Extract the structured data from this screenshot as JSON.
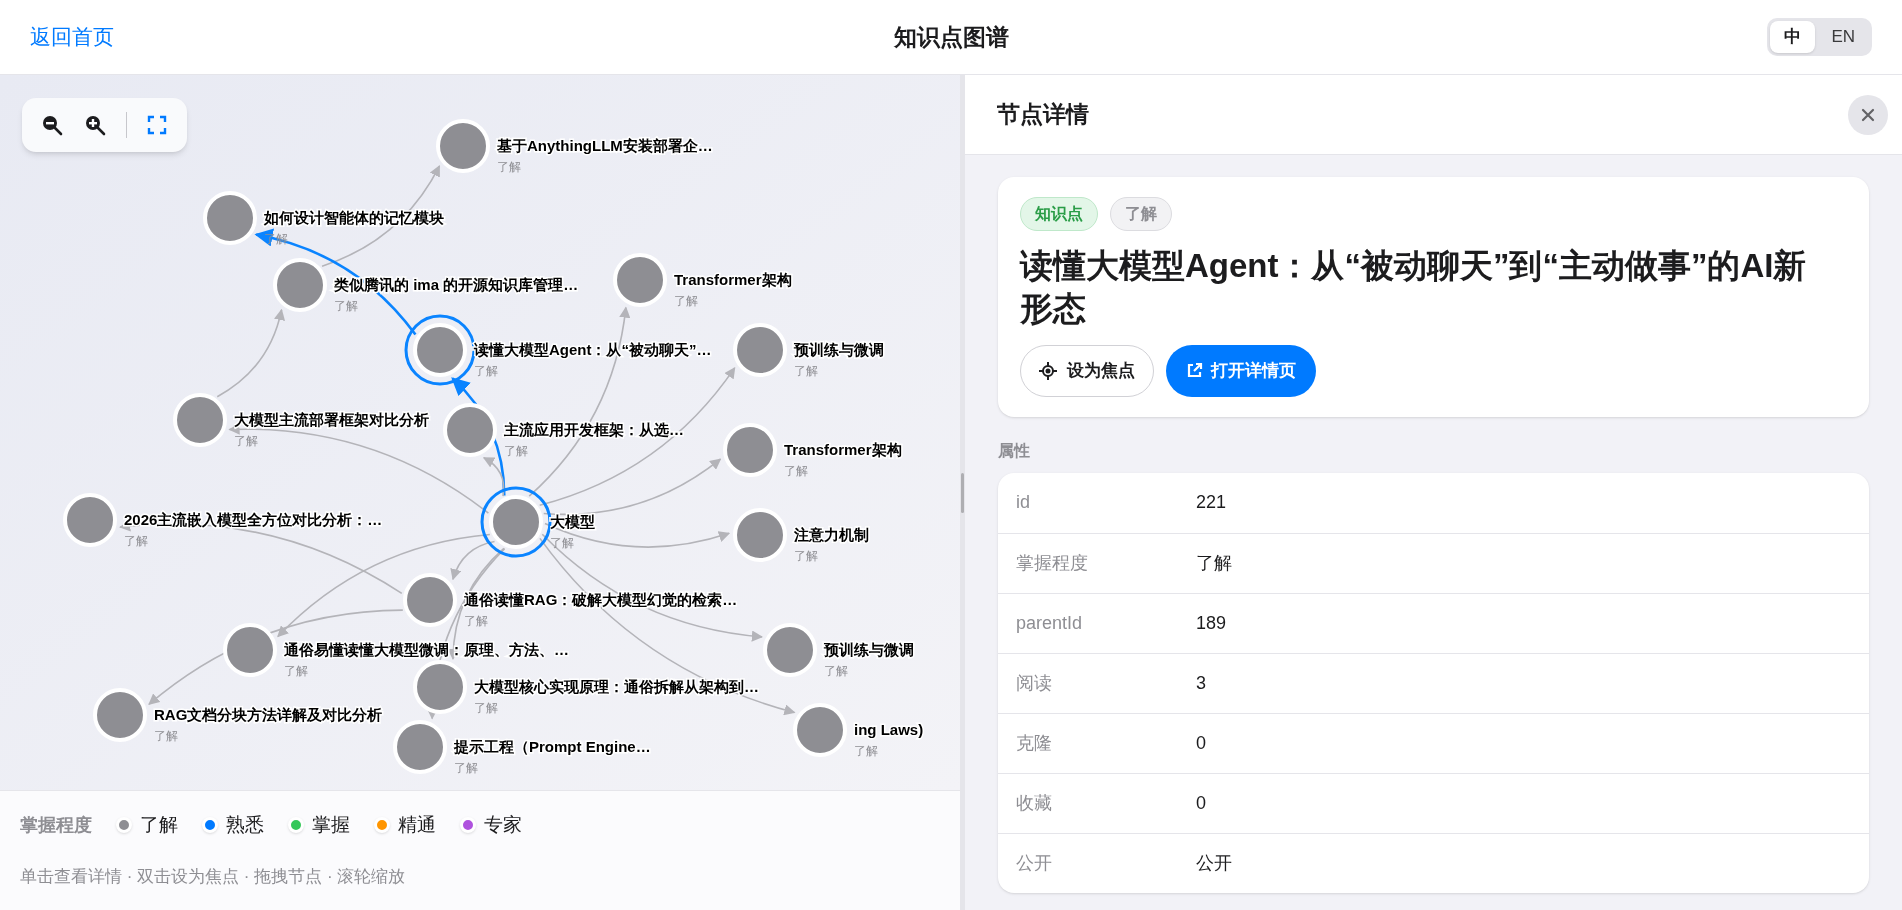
{
  "header": {
    "back_link": "返回首页",
    "title": "知识点图谱",
    "languages": [
      {
        "label": "中",
        "selected": true
      },
      {
        "label": "EN",
        "selected": false
      }
    ]
  },
  "graph": {
    "root": {
      "label": "大模型",
      "level": "了解",
      "color": "#8e8e93",
      "highlighted": true,
      "children": [
        {
          "label": "大模型主流部署框架对比分析",
          "level": "了解",
          "color": "#8e8e93",
          "highlighted": false,
          "link_highlighted": false,
          "children": [
            {
              "label": "类似腾讯的 ima 的开源知识库管理…",
              "level": "了解",
              "color": "#8e8e93",
              "highlighted": false,
              "link_highlighted": false,
              "children": [
                {
                  "label": "基于AnythingLLM安装部署企…",
                  "level": "了解",
                  "color": "#8e8e93",
                  "highlighted": false,
                  "link_highlighted": false
                }
              ]
            }
          ]
        },
        {
          "label": "读懂大模型Agent：从“被动聊天”…",
          "level": "了解",
          "color": "#8e8e93",
          "highlighted": true,
          "link_highlighted": true,
          "children": [
            {
              "label": "如何设计智能体的记忆模块",
              "level": "了解",
              "color": "#8e8e93",
              "highlighted": false,
              "link_highlighted": true
            }
          ]
        },
        {
          "label": "Transformer架构",
          "level": "了解",
          "color": "#8e8e93",
          "highlighted": false,
          "link_highlighted": false
        },
        {
          "label": "预训练与微调",
          "level": "了解",
          "color": "#8e8e93",
          "highlighted": false,
          "link_highlighted": false
        },
        {
          "label": "主流应用开发框架：从选…",
          "level": "了解",
          "color": "#8e8e93",
          "highlighted": false,
          "link_highlighted": false
        },
        {
          "label": "Transformer架构",
          "level": "了解",
          "color": "#8e8e93",
          "highlighted": false,
          "link_highlighted": false
        },
        {
          "label": "通俗读懂RAG：破解大模型幻觉的检索…",
          "level": "了解",
          "color": "#8e8e93",
          "highlighted": false,
          "link_highlighted": false,
          "children": [
            {
              "label": "2026主流嵌入模型全方位对比分析：…",
              "level": "了解",
              "color": "#8e8e93",
              "highlighted": false,
              "link_highlighted": false
            },
            {
              "label": "RAG文档分块方法详解及对比分析",
              "level": "了解",
              "color": "#8e8e93",
              "highlighted": false,
              "link_highlighted": false
            }
          ]
        },
        {
          "label": "注意力机制",
          "level": "了解",
          "color": "#8e8e93",
          "highlighted": false,
          "link_highlighted": false
        },
        {
          "label": "通俗易懂读懂大模型微调：原理、方法、…",
          "level": "了解",
          "color": "#8e8e93",
          "highlighted": false,
          "link_highlighted": false
        },
        {
          "label": "预训练与微调",
          "level": "了解",
          "color": "#8e8e93",
          "highlighted": false,
          "link_highlighted": false
        },
        {
          "label": "大模型核心实现原理：通俗拆解从架构到…",
          "level": "了解",
          "color": "#8e8e93",
          "highlighted": false,
          "link_highlighted": false
        },
        {
          "label": "ing Laws)",
          "level": "了解",
          "color": "#8e8e93",
          "highlighted": false,
          "link_highlighted": false
        },
        {
          "label": "提示工程（Prompt Engine…",
          "level": "了解",
          "color": "#8e8e93",
          "highlighted": false,
          "link_highlighted": false
        }
      ]
    }
  },
  "legend": {
    "title": "掌握程度",
    "items": [
      {
        "label": "了解",
        "color": "#8e8e93"
      },
      {
        "label": "熟悉",
        "color": "#007aff"
      },
      {
        "label": "掌握",
        "color": "#34c759"
      },
      {
        "label": "精通",
        "color": "#ff9500"
      },
      {
        "label": "专家",
        "color": "#af52de"
      }
    ],
    "hint": "单击查看详情 · 双击设为焦点 · 拖拽节点 · 滚轮缩放"
  },
  "detail": {
    "title": "节点详情",
    "tags": [
      {
        "kind": "type",
        "label": "知识点"
      },
      {
        "kind": "level",
        "label": "了解"
      }
    ],
    "node_title": "读懂大模型Agent：从“被动聊天”到“主动做事”的AI新形态",
    "buttons": [
      {
        "kind": "focus",
        "label": "设为焦点"
      },
      {
        "kind": "open",
        "label": "打开详情页"
      }
    ],
    "section_label": "属性",
    "properties": [
      {
        "key": "id",
        "value": "221"
      },
      {
        "key": "掌握程度",
        "value": "了解"
      },
      {
        "key": "parentId",
        "value": "189"
      },
      {
        "key": "阅读",
        "value": "3"
      },
      {
        "key": "克隆",
        "value": "0"
      },
      {
        "key": "收藏",
        "value": "0"
      },
      {
        "key": "公开",
        "value": "公开"
      }
    ]
  }
}
